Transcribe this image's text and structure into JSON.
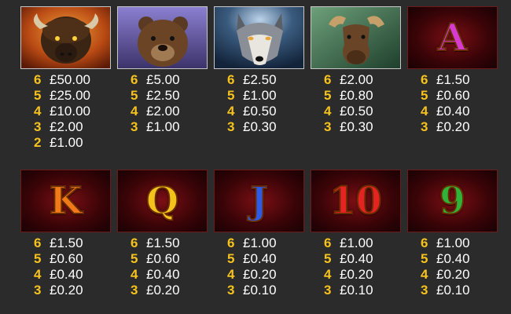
{
  "colors": {
    "background": "#2b2b2b",
    "count_yellow": "#f6c21d",
    "amount_white": "#ffffff",
    "letter_panel_red": "#7b0f14"
  },
  "symbols": [
    {
      "id": "buffalo",
      "kind": "animal",
      "icon": "buffalo-icon",
      "pays": [
        {
          "count": "6",
          "amount": "£50.00"
        },
        {
          "count": "5",
          "amount": "£25.00"
        },
        {
          "count": "4",
          "amount": "£10.00"
        },
        {
          "count": "3",
          "amount": "£2.00"
        },
        {
          "count": "2",
          "amount": "£1.00"
        }
      ]
    },
    {
      "id": "bear",
      "kind": "animal",
      "icon": "bear-icon",
      "pays": [
        {
          "count": "6",
          "amount": "£5.00"
        },
        {
          "count": "5",
          "amount": "£2.50"
        },
        {
          "count": "4",
          "amount": "£2.00"
        },
        {
          "count": "3",
          "amount": "£1.00"
        }
      ]
    },
    {
      "id": "wolf",
      "kind": "animal",
      "icon": "wolf-icon",
      "pays": [
        {
          "count": "6",
          "amount": "£2.50"
        },
        {
          "count": "5",
          "amount": "£1.00"
        },
        {
          "count": "4",
          "amount": "£0.50"
        },
        {
          "count": "3",
          "amount": "£0.30"
        }
      ]
    },
    {
      "id": "moose",
      "kind": "animal",
      "icon": "moose-icon",
      "pays": [
        {
          "count": "6",
          "amount": "£2.00"
        },
        {
          "count": "5",
          "amount": "£0.80"
        },
        {
          "count": "4",
          "amount": "£0.50"
        },
        {
          "count": "3",
          "amount": "£0.30"
        }
      ]
    },
    {
      "id": "a",
      "kind": "letter",
      "glyph": "A",
      "icon": "letter-a-icon",
      "fill": "#d63acf",
      "pays": [
        {
          "count": "6",
          "amount": "£1.50"
        },
        {
          "count": "5",
          "amount": "£0.60"
        },
        {
          "count": "4",
          "amount": "£0.40"
        },
        {
          "count": "3",
          "amount": "£0.20"
        }
      ]
    },
    {
      "id": "k",
      "kind": "letter",
      "glyph": "K",
      "icon": "letter-k-icon",
      "fill": "#f07a18",
      "pays": [
        {
          "count": "6",
          "amount": "£1.50"
        },
        {
          "count": "5",
          "amount": "£0.60"
        },
        {
          "count": "4",
          "amount": "£0.40"
        },
        {
          "count": "3",
          "amount": "£0.20"
        }
      ]
    },
    {
      "id": "q",
      "kind": "letter",
      "glyph": "Q",
      "icon": "letter-q-icon",
      "fill": "#f3c31b",
      "pays": [
        {
          "count": "6",
          "amount": "£1.50"
        },
        {
          "count": "5",
          "amount": "£0.60"
        },
        {
          "count": "4",
          "amount": "£0.40"
        },
        {
          "count": "3",
          "amount": "£0.20"
        }
      ]
    },
    {
      "id": "j",
      "kind": "letter",
      "glyph": "J",
      "icon": "letter-j-icon",
      "fill": "#2d5be8",
      "pays": [
        {
          "count": "6",
          "amount": "£1.00"
        },
        {
          "count": "5",
          "amount": "£0.40"
        },
        {
          "count": "4",
          "amount": "£0.20"
        },
        {
          "count": "3",
          "amount": "£0.10"
        }
      ]
    },
    {
      "id": "ten",
      "kind": "letter",
      "glyph": "10",
      "icon": "number-10-icon",
      "fill": "#e52323",
      "pays": [
        {
          "count": "6",
          "amount": "£1.00"
        },
        {
          "count": "5",
          "amount": "£0.40"
        },
        {
          "count": "4",
          "amount": "£0.20"
        },
        {
          "count": "3",
          "amount": "£0.10"
        }
      ]
    },
    {
      "id": "nine",
      "kind": "letter",
      "glyph": "9",
      "icon": "number-9-icon",
      "fill": "#2fb33a",
      "pays": [
        {
          "count": "6",
          "amount": "£1.00"
        },
        {
          "count": "5",
          "amount": "£0.40"
        },
        {
          "count": "4",
          "amount": "£0.20"
        },
        {
          "count": "3",
          "amount": "£0.10"
        }
      ]
    }
  ]
}
